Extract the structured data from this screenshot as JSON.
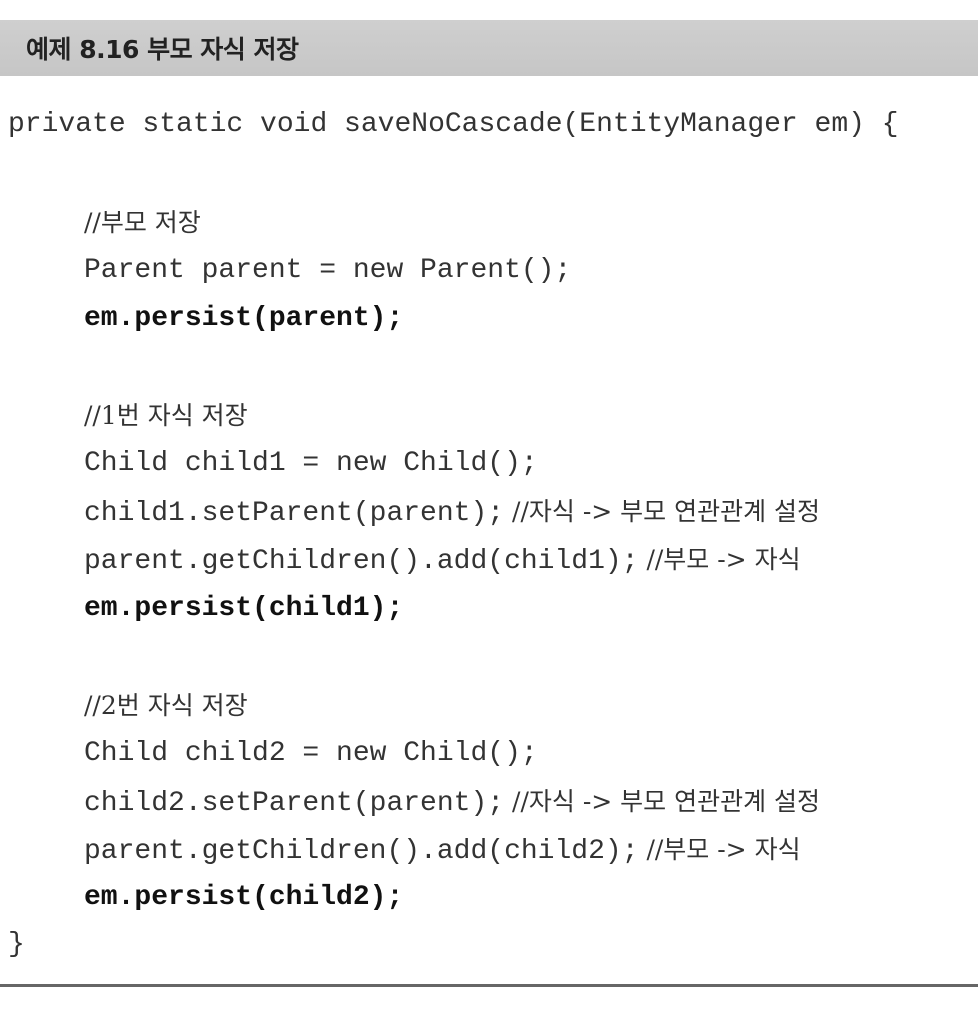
{
  "header": {
    "title": "예제 8.16 부모 자식 저장"
  },
  "code": {
    "method_signature": "private static void saveNoCascade(EntityManager em) {",
    "comment_parent": "//부모 저장",
    "line_parent_new": "Parent parent = new Parent();",
    "line_persist_parent": "em.persist(parent);",
    "comment_child1": "//1번 자식 저장",
    "line_child1_new": "Child child1 = new Child();",
    "line_child1_set": "child1.setParent(parent);",
    "comment_child1_set": " //자식 -> 부모 연관관계 설정",
    "line_child1_add": "parent.getChildren().add(child1);",
    "comment_child1_add": " //부모 -> 자식",
    "line_persist_child1": "em.persist(child1);",
    "comment_child2": "//2번 자식 저장",
    "line_child2_new": "Child child2 = new Child();",
    "line_child2_set": "child2.setParent(parent);",
    "comment_child2_set": " //자식 -> 부모 연관관계 설정",
    "line_child2_add": "parent.getChildren().add(child2);",
    "comment_child2_add": " //부모 -> 자식",
    "line_persist_child2": "em.persist(child2);",
    "closing_brace": "}"
  }
}
